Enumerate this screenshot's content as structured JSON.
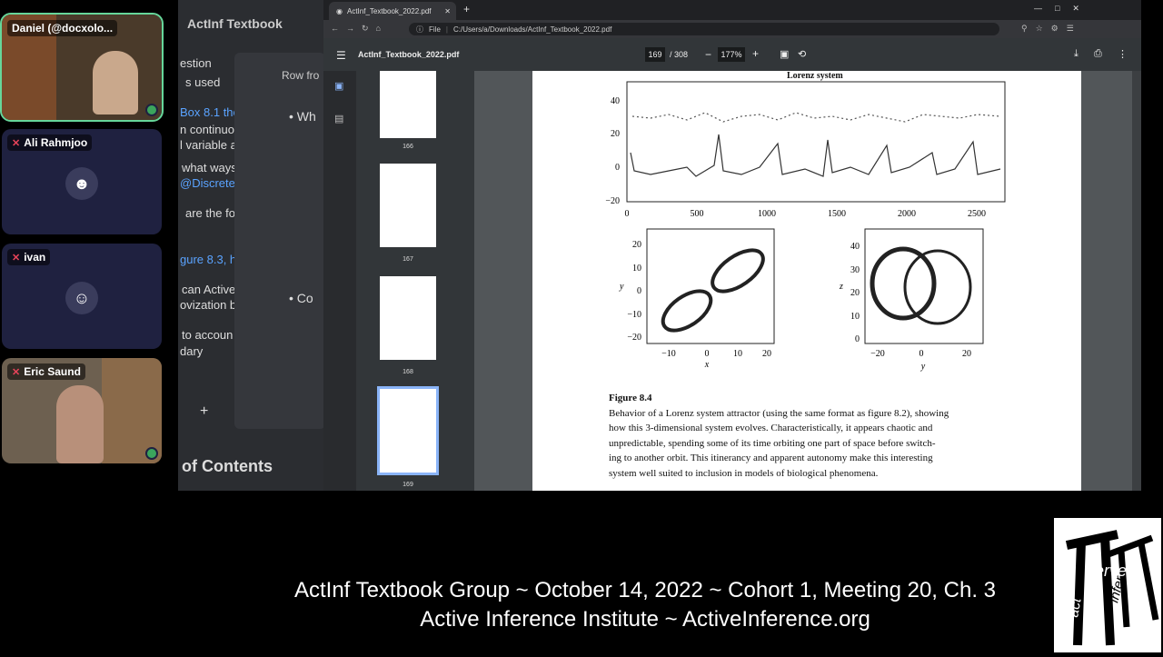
{
  "participants": [
    {
      "name": "Daniel (@docxolo...",
      "muted": false,
      "video": true
    },
    {
      "name": "Ali Rahmjoo",
      "muted": true,
      "video": false
    },
    {
      "name": "ivan",
      "muted": true,
      "video": false
    },
    {
      "name": "Eric Saund",
      "muted": true,
      "video": true
    }
  ],
  "notes": {
    "app_title": "ActInf Textbook",
    "lines": [
      "estion",
      "s used",
      "Box 8.1 the",
      "n continuo",
      "l variable a",
      "what ways",
      "@Discrete",
      "are the fo",
      "gure 8.3, h",
      "can Active",
      "ovization b",
      "to accoun",
      "dary"
    ],
    "panel_lines": [
      "Row fro",
      "Wh",
      "Co"
    ],
    "footer": "of Contents"
  },
  "browser": {
    "tab_title": "ActInf_Textbook_2022.pdf",
    "file_label": "File",
    "url": "C:/Users/a/Downloads/ActInf_Textbook_2022.pdf"
  },
  "pdf": {
    "filename": "ActInf_Textbook_2022.pdf",
    "page": "169",
    "total": "/ 308",
    "zoom": "177%",
    "thumbnails": [
      "166",
      "167",
      "168",
      "169"
    ]
  },
  "figure": {
    "top_title": "Lorenz system",
    "ts_y_ticks": [
      "40",
      "20",
      "0",
      "−20"
    ],
    "ts_x_ticks": [
      "0",
      "500",
      "1000",
      "1500",
      "2000",
      "2500"
    ],
    "left_y_ticks": [
      "20",
      "10",
      "0",
      "−10",
      "−20"
    ],
    "left_x_ticks": [
      "−10",
      "0",
      "10",
      "20"
    ],
    "left_xlabel": "x",
    "left_ylabel": "y",
    "right_y_ticks": [
      "40",
      "30",
      "20",
      "10",
      "0"
    ],
    "right_x_ticks": [
      "−20",
      "0",
      "20"
    ],
    "right_xlabel": "y",
    "right_ylabel": "z",
    "caption_title": "Figure 8.4",
    "caption_lines": [
      "Behavior of a Lorenz system attractor (using the same format as figure 8.2), showing",
      "how this 3-dimensional system evolves. Characteristically, it appears chaotic and",
      "unpredictable, spending some of its time orbiting one part of space before switch-",
      "ing to another orbit. This itinerancy and apparent autonomy make this interesting",
      "system well suited to inclusion in models of biological phenomena."
    ]
  },
  "subtitle": {
    "line1": "ActInf Textbook Group ~ October 14, 2022 ~ Cohort 1, Meeting 20, Ch. 3",
    "line2": "Active Inference Institute ~ ActiveInference.org"
  },
  "logo": {
    "word1": "serve",
    "word2": "act",
    "word3": "infer"
  }
}
